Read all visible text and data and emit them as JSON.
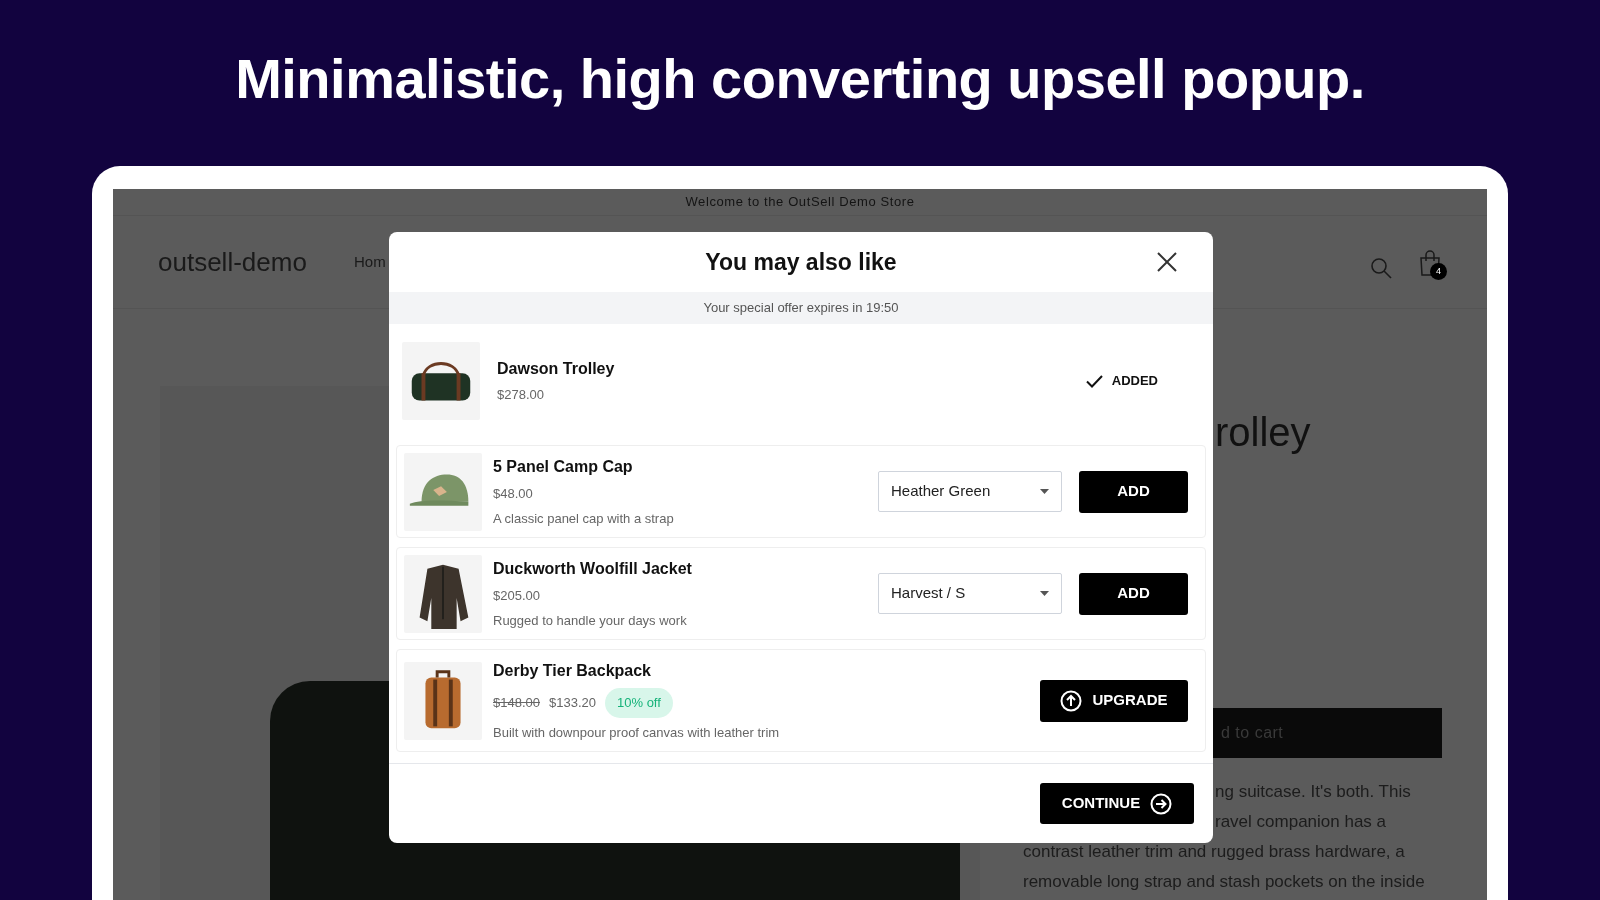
{
  "headline": "Minimalistic, high converting upsell popup.",
  "store": {
    "announcement": "Welcome to the OutSell Demo Store",
    "logo": "outsell-demo",
    "nav_item": "Hom",
    "cart_count": "4",
    "product_title": "rolley",
    "add_to_cart": "d to cart",
    "description_lines": [
      "ng suitcase. It's both. This",
      "ravel companion has a",
      "contrast leather trim and rugged brass hardware, a",
      "removable long strap and stash pockets on the inside"
    ]
  },
  "popup": {
    "title": "You may also like",
    "offer_text": "Your special offer expires in 19:50",
    "items": [
      {
        "kind": "added",
        "name": "Dawson Trolley",
        "price": "$278.00",
        "status": "ADDED"
      },
      {
        "kind": "variant",
        "name": "5 Panel Camp Cap",
        "price": "$48.00",
        "description": "A classic panel cap with a strap",
        "variant": "Heather Green",
        "button": "ADD"
      },
      {
        "kind": "variant",
        "name": "Duckworth Woolfill Jacket",
        "price": "$205.00",
        "description": "Rugged to handle your days work",
        "variant": "Harvest / S",
        "button": "ADD"
      },
      {
        "kind": "upgrade",
        "name": "Derby Tier Backpack",
        "original_price": "$148.00",
        "price": "$133.20",
        "discount": "10% off",
        "description": "Built with downpour proof canvas with leather trim",
        "button": "UPGRADE"
      }
    ],
    "continue_button": "CONTINUE"
  }
}
